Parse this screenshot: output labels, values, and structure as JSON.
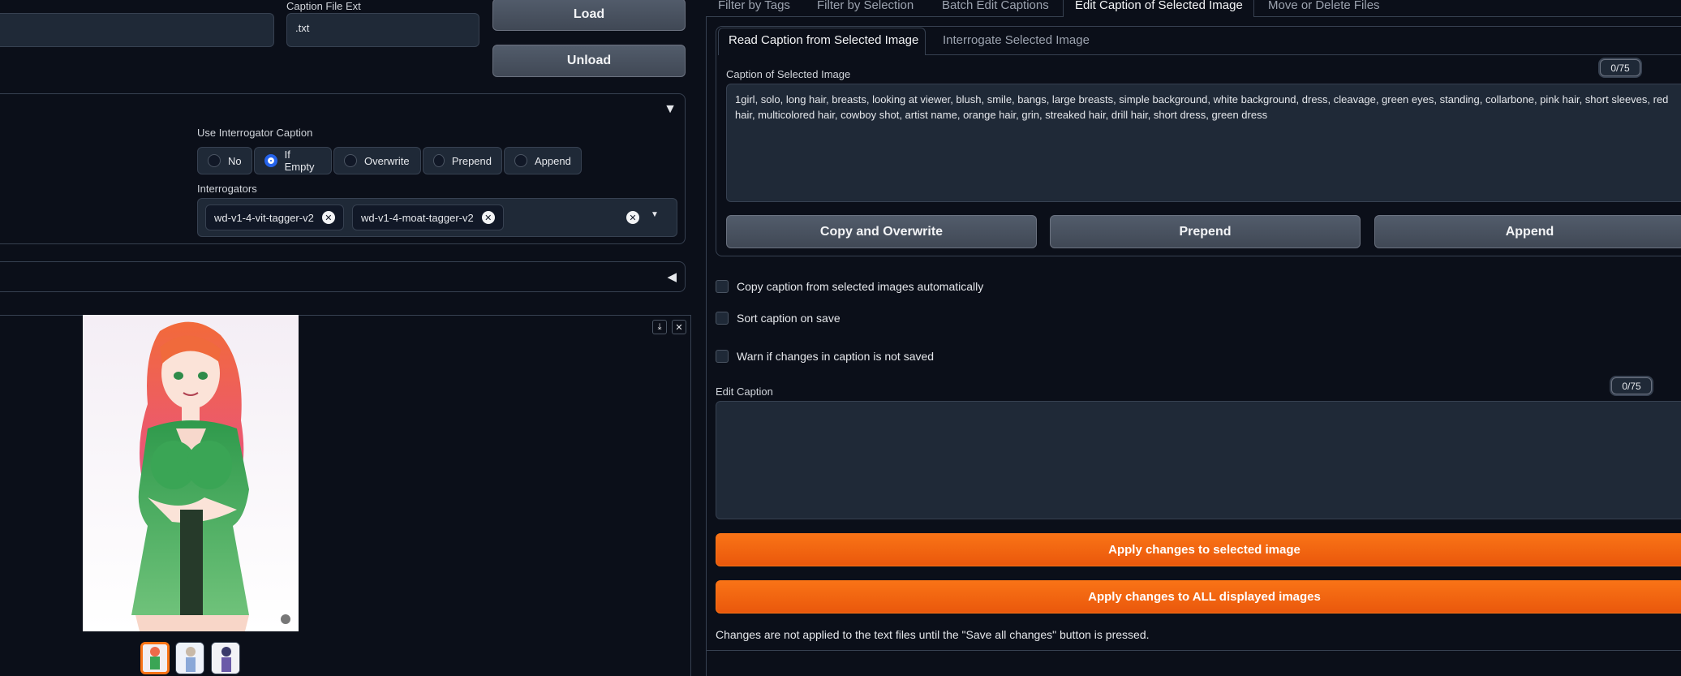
{
  "left": {
    "caption_file_ext_label": "Caption File Ext",
    "caption_file_ext_value": ".txt",
    "load_label": "Load",
    "unload_label": "Unload",
    "use_interrogator_label": "Use Interrogator Caption",
    "radio_options": [
      "No",
      "If Empty",
      "Overwrite",
      "Prepend",
      "Append"
    ],
    "radio_selected": "If Empty",
    "interrogators_label": "Interrogators",
    "interrogators": [
      "wd-v1-4-vit-tagger-v2",
      "wd-v1-4-moat-tagger-v2"
    ],
    "collapse_open_glyph": "▼",
    "collapse_closed_glyph": "◀"
  },
  "tabs": {
    "main": [
      "Filter by Tags",
      "Filter by Selection",
      "Batch Edit Captions",
      "Edit Caption of Selected Image",
      "Move or Delete Files"
    ],
    "main_active": "Edit Caption of Selected Image",
    "sub": [
      "Read Caption from Selected Image",
      "Interrogate Selected Image"
    ],
    "sub_active": "Read Caption from Selected Image"
  },
  "caption": {
    "label": "Caption of Selected Image",
    "counter": "0/75",
    "text": "1girl, solo, long hair, breasts, looking at viewer, blush, smile, bangs, large breasts, simple background, white background, dress, cleavage, green eyes, standing, collarbone, pink hair, short sleeves, red hair, multicolored hair, cowboy shot, artist name, orange hair, grin, streaked hair, drill hair, short dress, green dress",
    "copy_overwrite_label": "Copy and Overwrite",
    "prepend_label": "Prepend",
    "append_label": "Append"
  },
  "options": {
    "copy_auto": "Copy caption from selected images automatically",
    "sort_on_save": "Sort caption on save",
    "warn_unsaved": "Warn if changes in caption is not saved"
  },
  "edit": {
    "label": "Edit Caption",
    "counter": "0/75",
    "value": "",
    "apply_selected_label": "Apply changes to selected image",
    "apply_all_label": "Apply changes to ALL displayed images",
    "note": "Changes are not applied to the text files until the \"Save all changes\" button is pressed."
  },
  "colors": {
    "background": "#0b0f19",
    "accent_orange": "#f97316",
    "radio_selected": "#2563eb"
  }
}
